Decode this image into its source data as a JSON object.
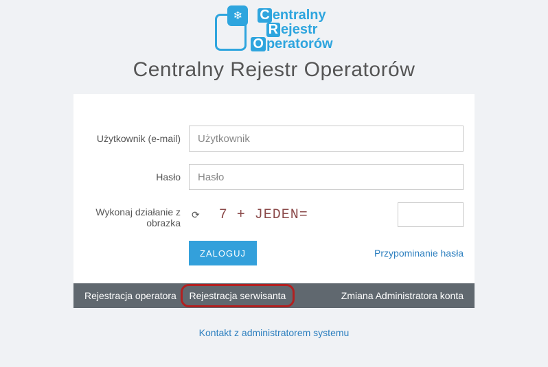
{
  "logo": {
    "line1_cap": "C",
    "line1_rest": "entralny",
    "line2_cap": "R",
    "line2_rest": "ejestr",
    "line3_cap": "O",
    "line3_rest": "peratorów",
    "snowflake": "❄"
  },
  "title": "Centralny Rejestr Operatorów",
  "form": {
    "user_label": "Użytkownik (e-mail)",
    "user_placeholder": "Użytkownik",
    "password_label": "Hasło",
    "password_placeholder": "Hasło",
    "captcha_label": "Wykonaj działanie z obrazka",
    "captcha_text": "7 + JEDEN=",
    "login_button": "ZALOGUJ",
    "remind_link": "Przypominanie hasła"
  },
  "bottom": {
    "operator": "Rejestracja operatora",
    "sep": "|",
    "servicer": "Rejestracja serwisanta",
    "change_admin": "Zmiana Administratora konta"
  },
  "footer": {
    "contact": "Kontakt z administratorem systemu"
  }
}
